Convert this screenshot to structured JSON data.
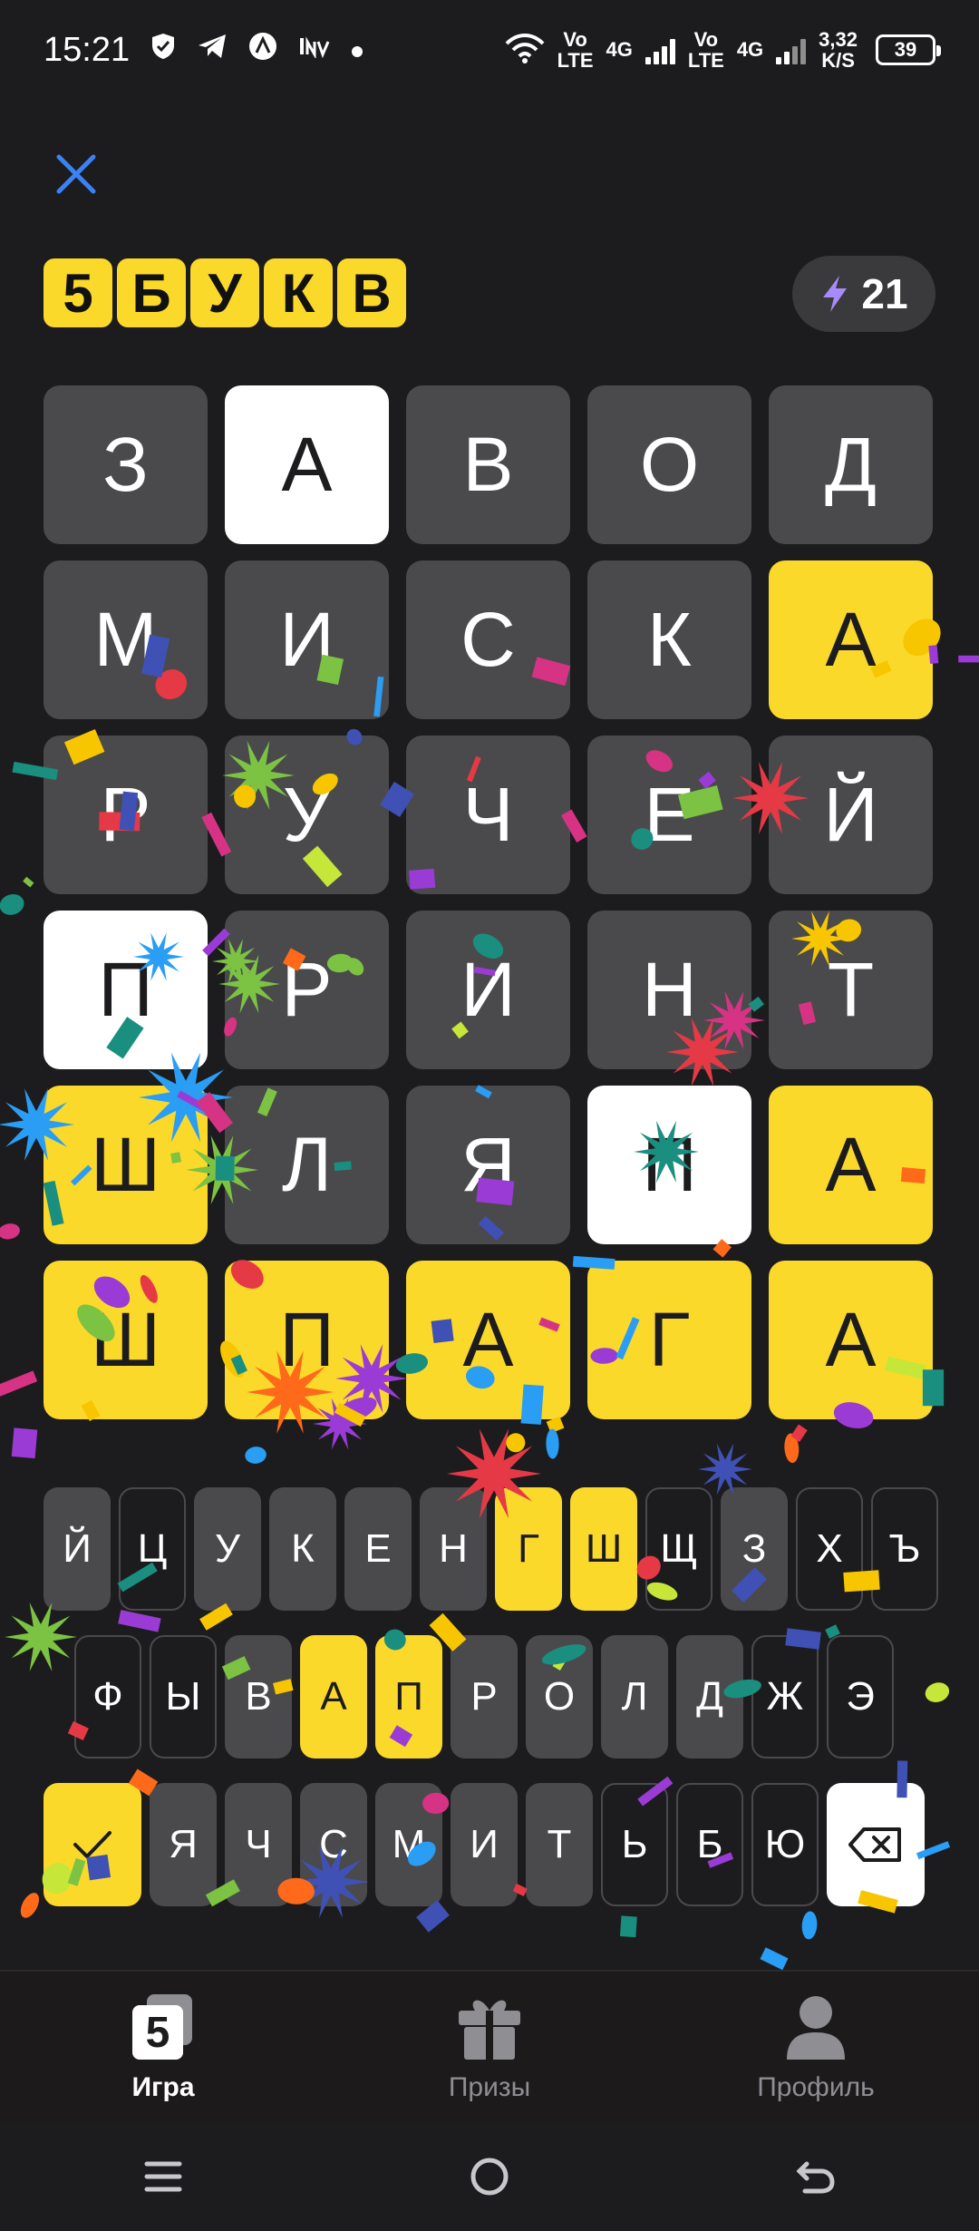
{
  "status_bar": {
    "time": "15:21",
    "net_speed_value": "3,32",
    "net_speed_unit": "K/S",
    "battery": "39",
    "net1_a": "Vo",
    "net1_b": "LTE",
    "net1_c": "4G",
    "net2_a": "Vo",
    "net2_b": "LTE",
    "net2_c": "4G"
  },
  "header": {
    "logo_letters": [
      "5",
      "Б",
      "У",
      "К",
      "В"
    ],
    "energy_count": "21"
  },
  "board": {
    "rows": [
      [
        {
          "l": "З",
          "s": "empty"
        },
        {
          "l": "А",
          "s": "present"
        },
        {
          "l": "В",
          "s": "empty"
        },
        {
          "l": "О",
          "s": "empty"
        },
        {
          "l": "Д",
          "s": "empty"
        }
      ],
      [
        {
          "l": "М",
          "s": "empty"
        },
        {
          "l": "И",
          "s": "empty"
        },
        {
          "l": "С",
          "s": "empty"
        },
        {
          "l": "К",
          "s": "empty"
        },
        {
          "l": "А",
          "s": "correct"
        }
      ],
      [
        {
          "l": "Р",
          "s": "empty"
        },
        {
          "l": "У",
          "s": "empty"
        },
        {
          "l": "Ч",
          "s": "empty"
        },
        {
          "l": "Е",
          "s": "empty"
        },
        {
          "l": "Й",
          "s": "empty"
        }
      ],
      [
        {
          "l": "П",
          "s": "present"
        },
        {
          "l": "Р",
          "s": "empty"
        },
        {
          "l": "И",
          "s": "empty"
        },
        {
          "l": "Н",
          "s": "empty"
        },
        {
          "l": "Т",
          "s": "empty"
        }
      ],
      [
        {
          "l": "Ш",
          "s": "correct"
        },
        {
          "l": "Л",
          "s": "empty"
        },
        {
          "l": "Я",
          "s": "empty"
        },
        {
          "l": "П",
          "s": "present"
        },
        {
          "l": "А",
          "s": "correct"
        }
      ],
      [
        {
          "l": "Ш",
          "s": "correct"
        },
        {
          "l": "П",
          "s": "correct"
        },
        {
          "l": "А",
          "s": "correct"
        },
        {
          "l": "Г",
          "s": "correct"
        },
        {
          "l": "А",
          "s": "correct"
        }
      ]
    ]
  },
  "keyboard": {
    "row1": [
      {
        "k": "Й",
        "s": "unused"
      },
      {
        "k": "Ц",
        "s": "absent"
      },
      {
        "k": "У",
        "s": "unused"
      },
      {
        "k": "К",
        "s": "unused"
      },
      {
        "k": "Е",
        "s": "unused"
      },
      {
        "k": "Н",
        "s": "unused"
      },
      {
        "k": "Г",
        "s": "correct"
      },
      {
        "k": "Ш",
        "s": "correct"
      },
      {
        "k": "Щ",
        "s": "absent"
      },
      {
        "k": "З",
        "s": "unused"
      },
      {
        "k": "Х",
        "s": "absent"
      },
      {
        "k": "Ъ",
        "s": "absent"
      }
    ],
    "row2": [
      {
        "k": "Ф",
        "s": "absent"
      },
      {
        "k": "Ы",
        "s": "absent"
      },
      {
        "k": "В",
        "s": "unused"
      },
      {
        "k": "А",
        "s": "correct"
      },
      {
        "k": "П",
        "s": "correct"
      },
      {
        "k": "Р",
        "s": "unused"
      },
      {
        "k": "О",
        "s": "unused"
      },
      {
        "k": "Л",
        "s": "unused"
      },
      {
        "k": "Д",
        "s": "unused"
      },
      {
        "k": "Ж",
        "s": "absent"
      },
      {
        "k": "Э",
        "s": "absent"
      }
    ],
    "row3": [
      {
        "k": "Я",
        "s": "unused"
      },
      {
        "k": "Ч",
        "s": "unused"
      },
      {
        "k": "С",
        "s": "unused"
      },
      {
        "k": "М",
        "s": "unused"
      },
      {
        "k": "И",
        "s": "unused"
      },
      {
        "k": "Т",
        "s": "unused"
      },
      {
        "k": "Ь",
        "s": "absent"
      },
      {
        "k": "Б",
        "s": "absent"
      },
      {
        "k": "Ю",
        "s": "absent"
      }
    ]
  },
  "bottom_nav": {
    "items": [
      {
        "label": "Игра",
        "icon": "game-5-icon",
        "active": true
      },
      {
        "label": "Призы",
        "icon": "gift-icon",
        "active": false
      },
      {
        "label": "Профиль",
        "icon": "profile-icon",
        "active": false
      }
    ]
  },
  "colors": {
    "background": "#1c1c1e",
    "tile_empty": "#4a4a4c",
    "tile_correct": "#fbd92a",
    "tile_present": "#ffffff",
    "close_icon": "#3b82f6",
    "energy_bolt": "#a78bfa"
  }
}
